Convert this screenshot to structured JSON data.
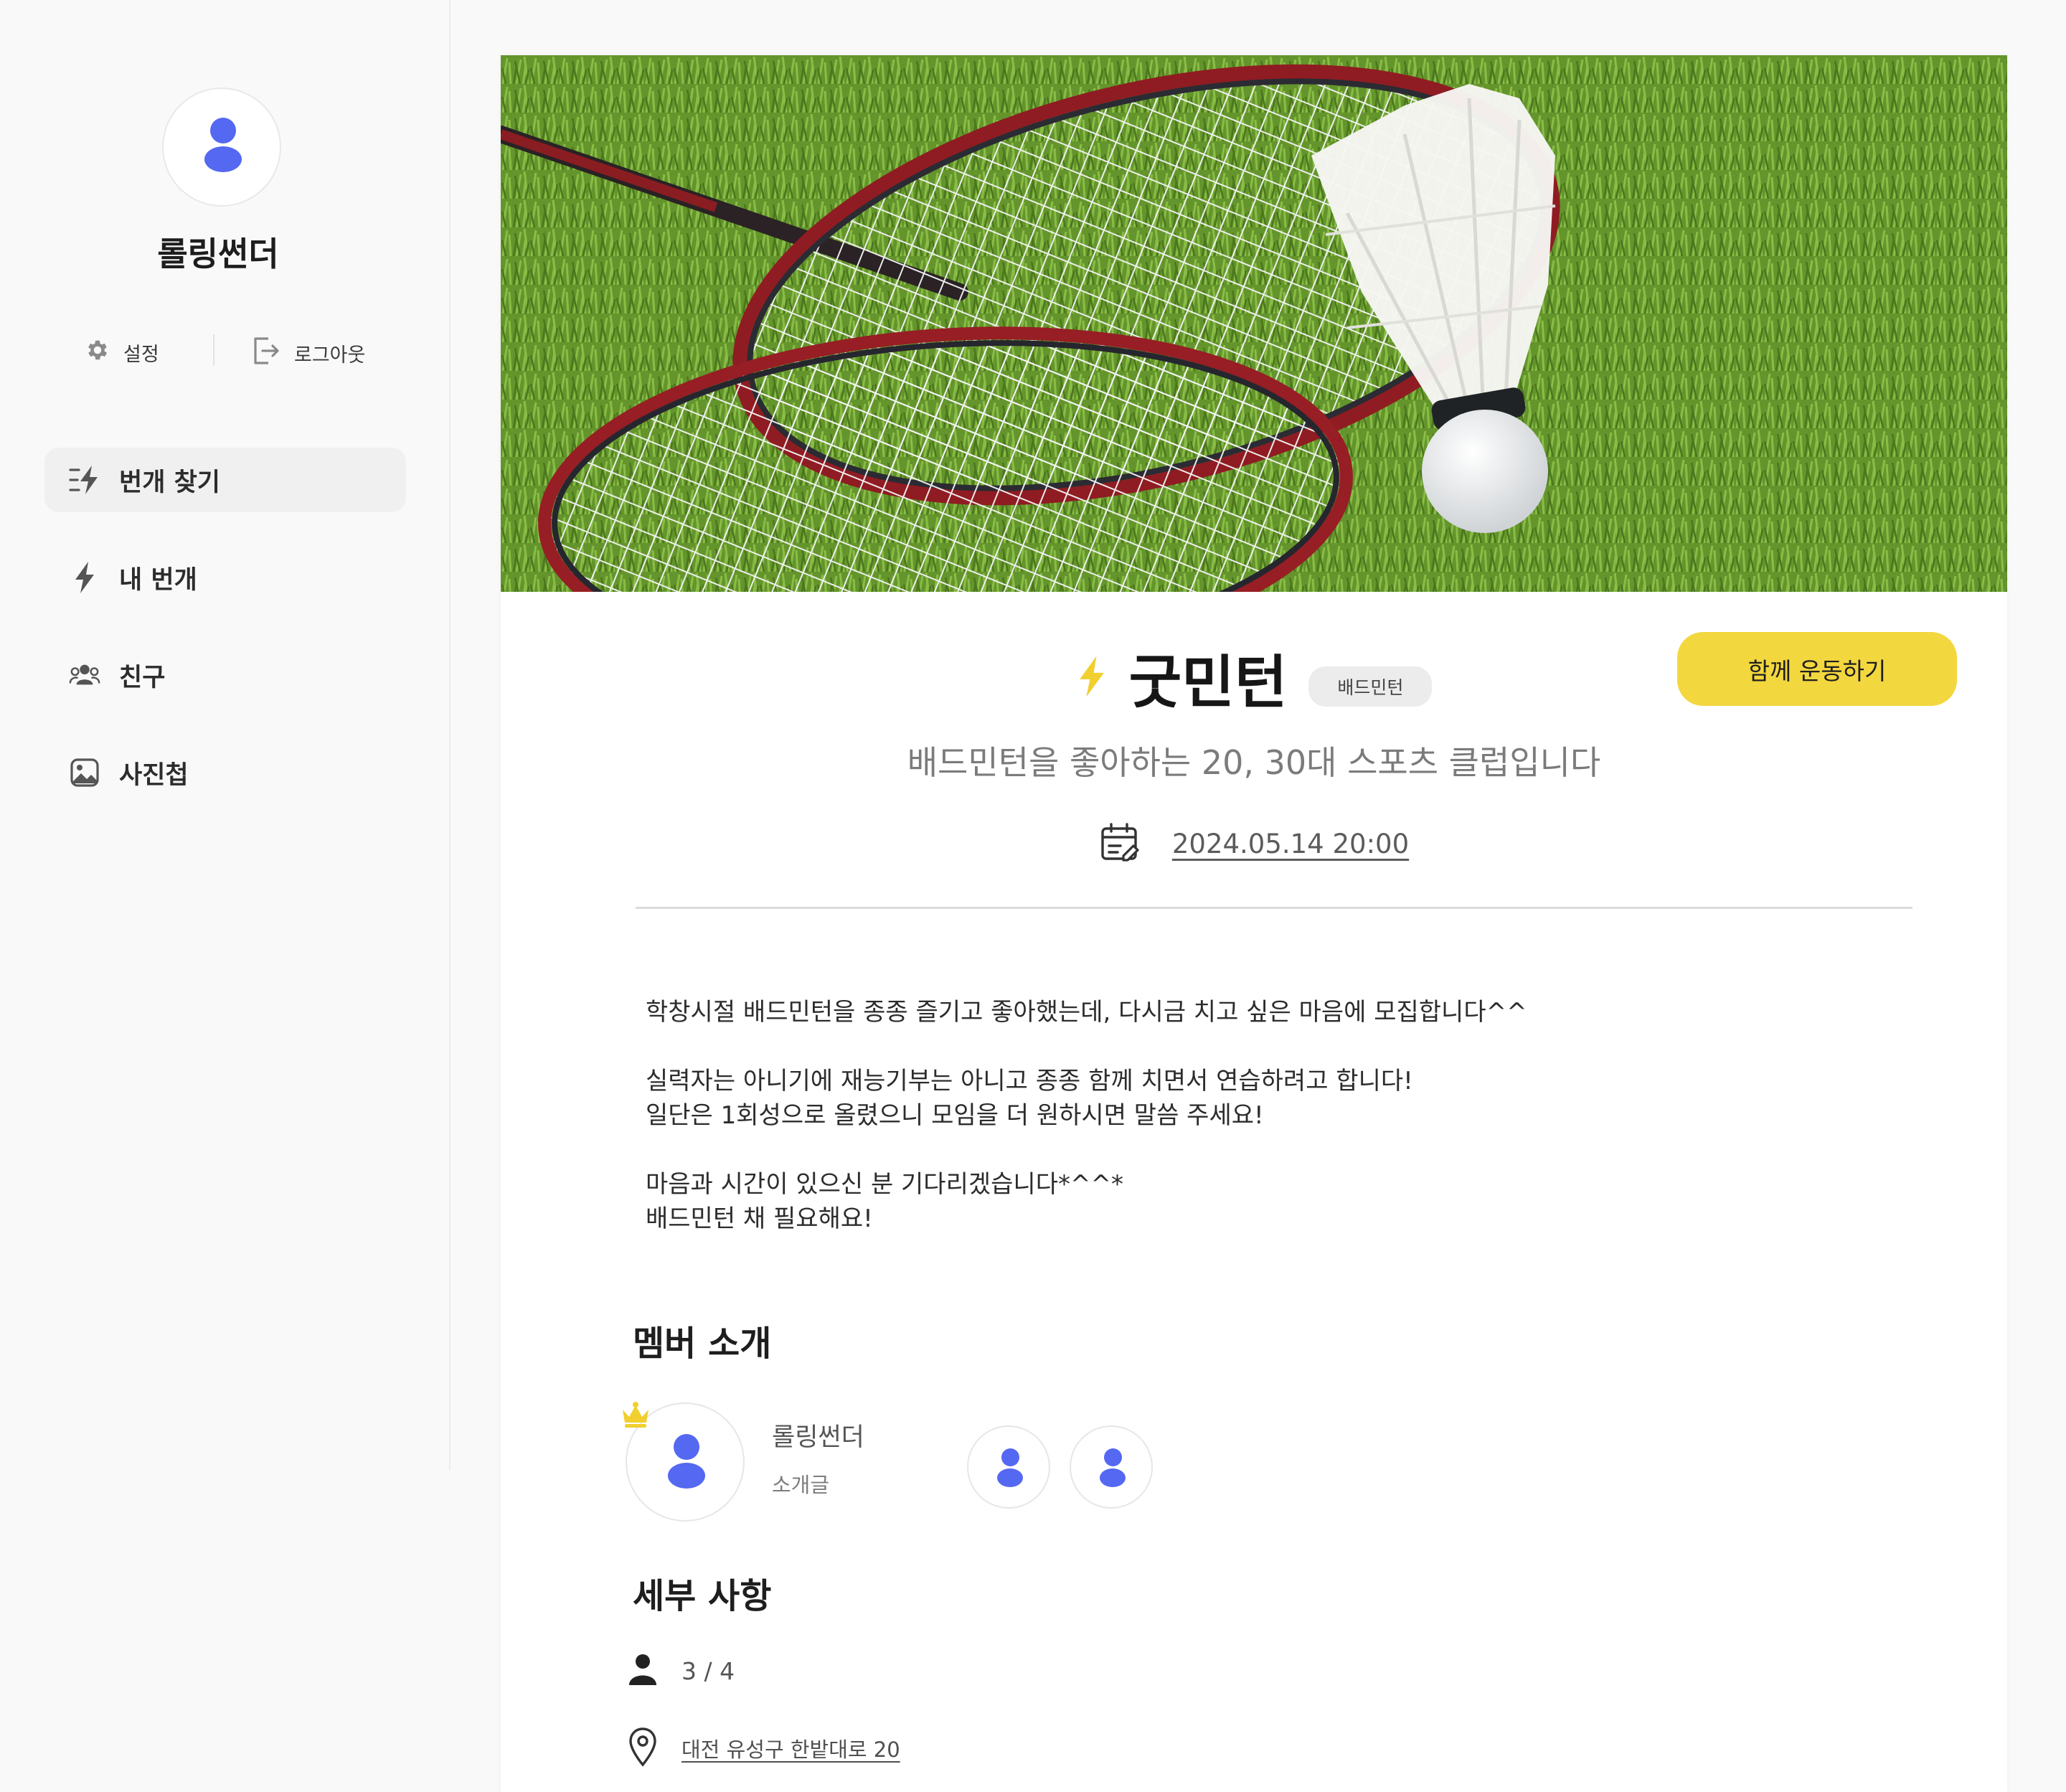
{
  "sidebar": {
    "user_name": "롤링썬더",
    "settings_label": "설정",
    "logout_label": "로그아웃",
    "nav": [
      {
        "label": "번개 찾기",
        "icon": "bolt-search-icon",
        "active": true
      },
      {
        "label": "내 번개",
        "icon": "bolt-icon"
      },
      {
        "label": "친구",
        "icon": "friends-icon"
      },
      {
        "label": "사진첩",
        "icon": "photo-album-icon"
      }
    ]
  },
  "meetup": {
    "hero_icon": "badminton-photo",
    "title_icon": "bolt-icon",
    "title": "굿민턴",
    "category": "배드민턴",
    "join_label": "함께 운동하기",
    "subtitle": "배드민턴을 좋아하는 20, 30대 스포츠 클럽입니다",
    "date_icon": "calendar-edit-icon",
    "datetime": "2024.05.14  20:00",
    "description": [
      "학창시절 배드민턴을 종종 즐기고 좋아했는데, 다시금 치고 싶은 마음에 모집합니다^^",
      "실력자는 아니기에 재능기부는 아니고 종종 함께 치면서 연습하려고 합니다!",
      "일단은 1회성으로 올렸으니 모임을 더 원하시면 말씀 주세요!",
      "마음과 시간이 있으신 분 기다리겠습니다*^^*",
      "배드민턴 채 필요해요!"
    ]
  },
  "members": {
    "section_title": "멤버 소개",
    "host_icon": "crown-icon",
    "host_name": "롤링썬더",
    "host_intro": "소개글"
  },
  "details": {
    "section_title": "세부 사항",
    "participants": "3 / 4",
    "address": "대전 유성구 한밭대로 20"
  },
  "colors": {
    "accent_yellow": "#f3d73f",
    "avatar_blue": "#5468f2"
  }
}
